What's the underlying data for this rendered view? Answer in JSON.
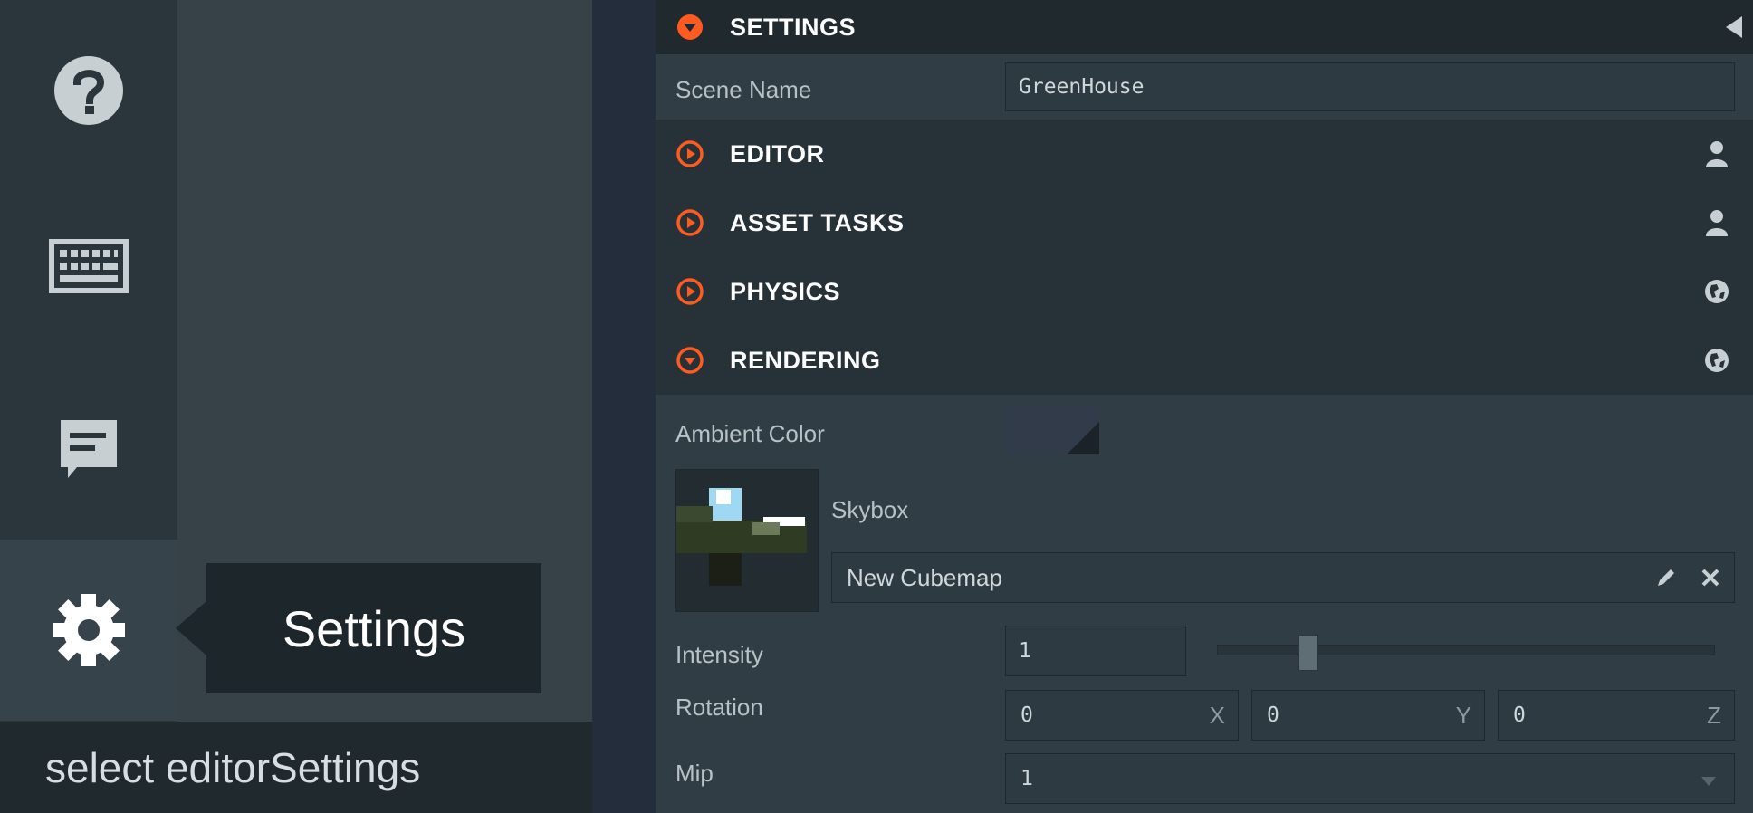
{
  "sidebar": {
    "tools": [
      {
        "icon": "help-icon"
      },
      {
        "icon": "keyboard-icon"
      },
      {
        "icon": "chat-icon"
      },
      {
        "icon": "gear-icon"
      }
    ],
    "tooltip": "Settings"
  },
  "statusbar": {
    "text": "select editorSettings"
  },
  "inspector": {
    "header": {
      "title": "SETTINGS",
      "icon": "chevron-down-circle-icon",
      "collapse_icon": "collapse-left-icon"
    },
    "scene_name": {
      "label": "Scene Name",
      "value": "GreenHouse"
    },
    "sections": [
      {
        "title": "EDITOR",
        "state": "collapsed",
        "scope_icon": "user-icon"
      },
      {
        "title": "ASSET TASKS",
        "state": "collapsed",
        "scope_icon": "user-icon"
      },
      {
        "title": "PHYSICS",
        "state": "collapsed",
        "scope_icon": "globe-icon"
      },
      {
        "title": "RENDERING",
        "state": "expanded",
        "scope_icon": "globe-icon"
      }
    ],
    "rendering": {
      "ambient_color": {
        "label": "Ambient Color",
        "value": "#323b4a"
      },
      "skybox": {
        "label": "Skybox",
        "asset": "New Cubemap",
        "edit_icon": "pencil-icon",
        "clear_icon": "close-icon"
      },
      "intensity": {
        "label": "Intensity",
        "value": "1",
        "slider_fraction": 0.12
      },
      "rotation": {
        "label": "Rotation",
        "x": "0",
        "y": "0",
        "z": "0",
        "x_label": "X",
        "y_label": "Y",
        "z_label": "Z"
      },
      "mip": {
        "label": "Mip",
        "value": "1"
      }
    }
  },
  "colors": {
    "accent": "#ff5a1f",
    "panel": "#2b363d",
    "header": "#273238",
    "toolbar": "#2a353c"
  }
}
